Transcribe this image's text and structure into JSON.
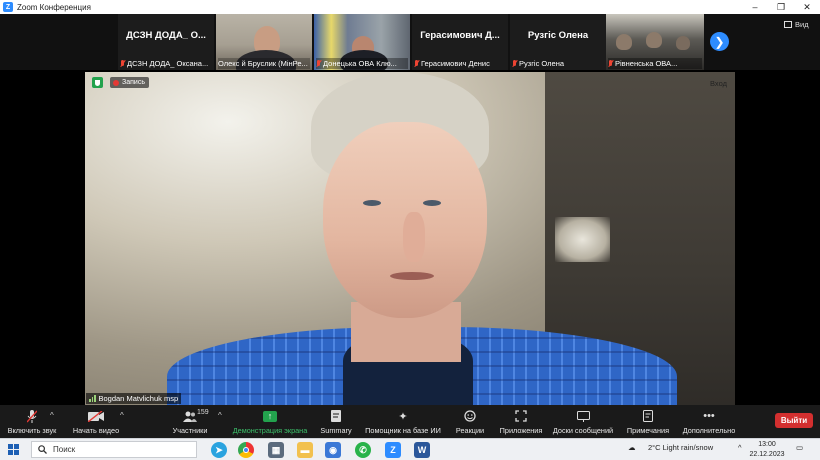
{
  "window": {
    "app_icon": "Z",
    "title": "Zoom Конференция",
    "controls": [
      "–",
      "❐",
      "✕"
    ]
  },
  "gallery": {
    "tiles": [
      {
        "big_name": "ДСЗН ДОДА_ О...",
        "caption": "ДСЗН ДОДА_ Оксана...",
        "has_video": false
      },
      {
        "big_name": "",
        "caption": "Олекс й Бруслик (МінРе...",
        "has_video": true
      },
      {
        "big_name": "",
        "caption": "Донецька ОВА Клю...",
        "has_video": true
      },
      {
        "big_name": "Герасимович Д...",
        "caption": "Герасимович Денис",
        "has_video": false
      },
      {
        "big_name": "Рузгіс Олена",
        "caption": "Рузгіс Олена",
        "has_video": false
      },
      {
        "big_name": "",
        "caption": "Рівненська ОВА...",
        "has_video": true
      }
    ],
    "next_icon": "❯",
    "view_label": "Вид"
  },
  "main_video": {
    "record_label": "Запись",
    "enter_label": "Вход",
    "speaker_name": "Bogdan Matvlichuk msp"
  },
  "toolbar": {
    "items": [
      {
        "label": "Включить звук",
        "icon": "mic-muted-icon"
      },
      {
        "label": "Начать видео",
        "icon": "video-off-icon"
      },
      {
        "label": "Участники",
        "icon": "participants-icon",
        "count": "159"
      },
      {
        "label": "Демонстрация экрана",
        "icon": "share-screen-icon"
      },
      {
        "label": "Summary",
        "icon": "summary-icon"
      },
      {
        "label": "Помощник на базе ИИ",
        "icon": "ai-assistant-icon"
      },
      {
        "label": "Реакции",
        "icon": "reactions-icon"
      },
      {
        "label": "Приложения",
        "icon": "apps-icon"
      },
      {
        "label": "Доски сообщений",
        "icon": "whiteboards-icon"
      },
      {
        "label": "Примечания",
        "icon": "notes-icon"
      },
      {
        "label": "Дополнительно",
        "icon": "more-icon"
      }
    ],
    "exit_label": "Выйти"
  },
  "taskbar": {
    "search_placeholder": "Поиск",
    "weather": "2°C  Light rain/snow",
    "time": "13:00",
    "date": "22.12.2023"
  }
}
